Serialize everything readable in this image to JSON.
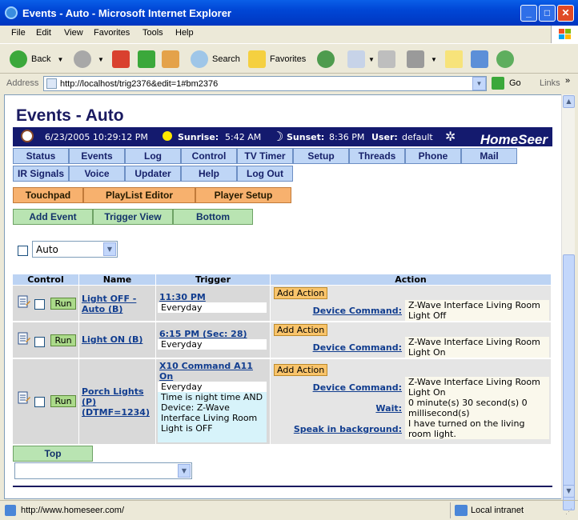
{
  "window": {
    "title": "Events - Auto - Microsoft Internet Explorer",
    "min": "_",
    "max": "□",
    "close": "✕"
  },
  "menu": [
    "File",
    "Edit",
    "View",
    "Favorites",
    "Tools",
    "Help"
  ],
  "toolbar": {
    "back": "Back",
    "search": "Search",
    "favorites": "Favorites"
  },
  "address": {
    "label": "Address",
    "url": "http://localhost/trig2376&edit=1#bm2376",
    "go": "Go",
    "links": "Links"
  },
  "page": {
    "title": "Events - Auto",
    "info": {
      "datetime": "6/23/2005 10:29:12 PM",
      "sunrise_label": "Sunrise:",
      "sunrise": "5:42 AM",
      "sunset_label": "Sunset:",
      "sunset": "8:36 PM",
      "user_label": "User:",
      "user": "default",
      "brand": "HomeSeer"
    },
    "nav_row1": [
      "Status",
      "Events",
      "Log",
      "Control",
      "TV Timer",
      "Setup",
      "Threads",
      "Phone",
      "Mail"
    ],
    "nav_row2": [
      "IR Signals",
      "Voice",
      "Updater",
      "Help",
      "Log Out"
    ],
    "nav_row3": [
      "Touchpad",
      "PlayList Editor",
      "Player Setup"
    ],
    "nav_row4": [
      "Add Event",
      "Trigger View",
      "Bottom"
    ],
    "group_select": "Auto",
    "columns": [
      "Control",
      "Name",
      "Trigger",
      "Action"
    ],
    "run_label": "Run",
    "add_action": "Add Action",
    "events": [
      {
        "name": "Light OFF - Auto (B)",
        "trigger_time": "11:30 PM",
        "trigger_desc": "Everyday",
        "actions": [
          {
            "label": "Device Command:",
            "value": "Z-Wave Interface Living Room Light Off"
          }
        ]
      },
      {
        "name": "Light ON (B)",
        "trigger_time": "6:15 PM (Sec: 28)",
        "trigger_desc": "Everyday",
        "actions": [
          {
            "label": "Device Command:",
            "value": "Z-Wave Interface Living Room Light On"
          }
        ]
      },
      {
        "name": "Porch Lights (P) (DTMF=1234)",
        "trigger_time": "X10 Command A11 On",
        "trigger_desc": "Everyday",
        "trigger_cond": "Time is night time AND Device: Z-Wave Interface Living Room Light is OFF",
        "actions": [
          {
            "label": "Device Command:",
            "value": "Z-Wave Interface Living Room Light On"
          },
          {
            "label": "Wait:",
            "value": "0 minute(s) 30 second(s) 0 millisecond(s)"
          },
          {
            "label": "Speak in background:",
            "value": "I have turned on the living room light."
          }
        ]
      }
    ],
    "top_button": "Top"
  },
  "status": {
    "url": "http://www.homeseer.com/",
    "zone": "Local intranet"
  }
}
